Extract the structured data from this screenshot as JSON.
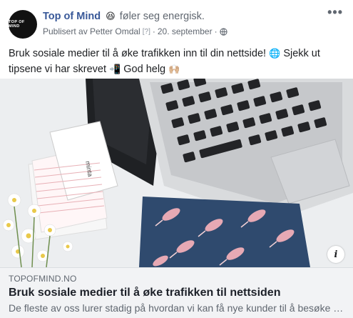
{
  "header": {
    "page_name": "Top of Mind",
    "avatar_text": "TOP OF MIND",
    "feeling_emoji": "😆",
    "feeling_text": "føler seg energisk.",
    "published_by": "Publisert av Petter Omdal",
    "published_flag": "[?]",
    "separator": "·",
    "date": "20. september",
    "separator2": "·",
    "privacy_icon": "globe-icon",
    "more_icon": "more-icon"
  },
  "post": {
    "message_part1": "Bruk sosiale medier til å øke trafikken inn til din nettside!",
    "emoji_globe": "🌐",
    "message_part2": "Sjekk ut tipsene vi har skrevet",
    "emoji_phone": "📲",
    "message_part3": "God helg",
    "emoji_hands": "🙌🏼"
  },
  "image": {
    "notebook_label": "minta",
    "info_icon": "i"
  },
  "link": {
    "domain": "TOPOFMIND.NO",
    "title": "Bruk sosiale medier til å øke trafikken til nettsiden",
    "description": "De fleste av oss lurer stadig på hvordan vi kan få nye kunder til å besøke nettsiden"
  },
  "colors": {
    "accent": "#385898",
    "caption_bg": "#f2f3f5",
    "notebook_blue": "#2f4a6e",
    "bird_pink": "#e7a9b4"
  }
}
